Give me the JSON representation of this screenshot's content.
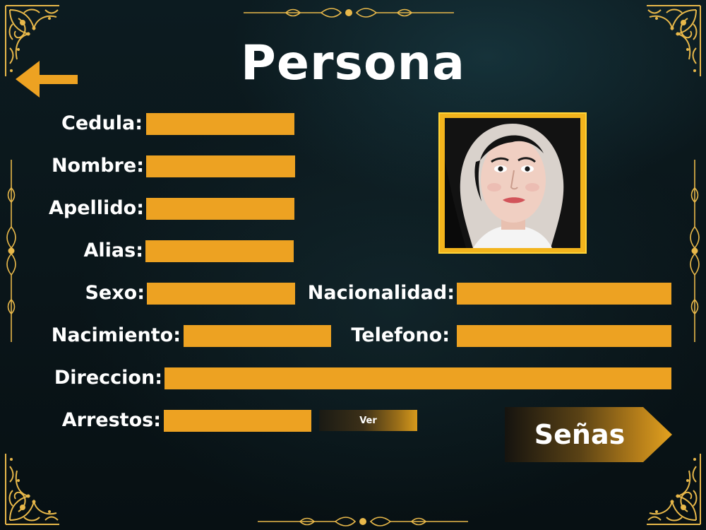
{
  "title": "Persona",
  "labels": {
    "cedula": "Cedula:",
    "nombre": "Nombre:",
    "apellido": "Apellido:",
    "alias": "Alias:",
    "sexo": "Sexo:",
    "nacionalidad": "Nacionalidad:",
    "nacimiento": "Nacimiento:",
    "telefono": "Telefono:",
    "direccion": "Direccion:",
    "arrestos": "Arrestos:"
  },
  "fields": {
    "cedula": "",
    "nombre": "",
    "apellido": "",
    "alias": "",
    "sexo": "",
    "nacionalidad": "",
    "nacimiento": "",
    "telefono": "",
    "direccion": "",
    "arrestos": ""
  },
  "buttons": {
    "ver": "Ver",
    "senas": "Señas"
  },
  "icons": {
    "back": "back-arrow-icon",
    "photo": "person-photo"
  },
  "colors": {
    "accent": "#eda222",
    "ornament": "#e8b84a",
    "background": "#0b171b"
  }
}
